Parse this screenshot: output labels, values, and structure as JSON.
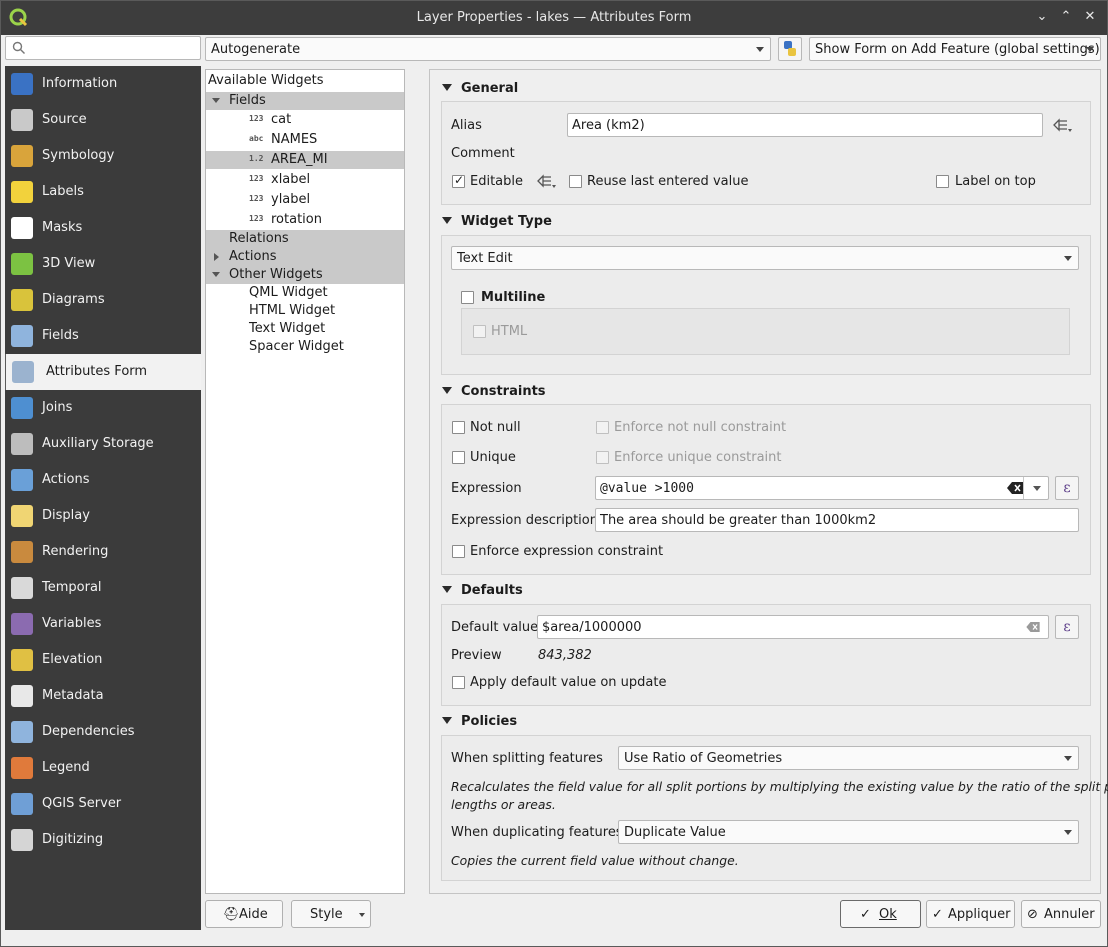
{
  "window": {
    "title": "Layer Properties - lakes — Attributes Form"
  },
  "search": {
    "placeholder": ""
  },
  "sidebar": {
    "items": [
      {
        "label": "Information",
        "icon": "information-icon",
        "color": "#3a72c4"
      },
      {
        "label": "Source",
        "icon": "source-icon",
        "color": "#c9c9c9"
      },
      {
        "label": "Symbology",
        "icon": "symbology-icon",
        "color": "#d9a43b"
      },
      {
        "label": "Labels",
        "icon": "labels-icon",
        "color": "#f2d23c"
      },
      {
        "label": "Masks",
        "icon": "masks-icon",
        "color": "#ffffff"
      },
      {
        "label": "3D View",
        "icon": "3d-view-icon",
        "color": "#7cc242"
      },
      {
        "label": "Diagrams",
        "icon": "diagrams-icon",
        "color": "#d9c33b"
      },
      {
        "label": "Fields",
        "icon": "fields-icon",
        "color": "#8fb4dd"
      },
      {
        "label": "Attributes Form",
        "icon": "attributes-form-icon",
        "color": "#9bb3cf"
      },
      {
        "label": "Joins",
        "icon": "joins-icon",
        "color": "#4e8fd1"
      },
      {
        "label": "Auxiliary Storage",
        "icon": "auxiliary-storage-icon",
        "color": "#bdbdbd"
      },
      {
        "label": "Actions",
        "icon": "actions-icon",
        "color": "#6aa0d8"
      },
      {
        "label": "Display",
        "icon": "display-icon",
        "color": "#f0d573"
      },
      {
        "label": "Rendering",
        "icon": "rendering-icon",
        "color": "#c98a3e"
      },
      {
        "label": "Temporal",
        "icon": "temporal-icon",
        "color": "#d9d9d9"
      },
      {
        "label": "Variables",
        "icon": "variables-icon",
        "color": "#8b6bb0"
      },
      {
        "label": "Elevation",
        "icon": "elevation-icon",
        "color": "#e0c043"
      },
      {
        "label": "Metadata",
        "icon": "metadata-icon",
        "color": "#e8e8e8"
      },
      {
        "label": "Dependencies",
        "icon": "dependencies-icon",
        "color": "#8fb4dd"
      },
      {
        "label": "Legend",
        "icon": "legend-icon",
        "color": "#e07a3b"
      },
      {
        "label": "QGIS Server",
        "icon": "qgis-server-icon",
        "color": "#6f9fd6"
      },
      {
        "label": "Digitizing",
        "icon": "digitizing-icon",
        "color": "#d5d5d5"
      }
    ],
    "selected_index": 8
  },
  "toolbar": {
    "layout_mode": "Autogenerate",
    "show_form": "Show Form on Add Feature (global settings)"
  },
  "tree": {
    "header": "Available Widgets",
    "fields_label": "Fields",
    "fields": [
      {
        "type": "123",
        "name": "cat"
      },
      {
        "type": "abc",
        "name": "NAMES"
      },
      {
        "type": "1.2",
        "name": "AREA_MI"
      },
      {
        "type": "123",
        "name": "xlabel"
      },
      {
        "type": "123",
        "name": "ylabel"
      },
      {
        "type": "123",
        "name": "rotation"
      }
    ],
    "relations_label": "Relations",
    "actions_label": "Actions",
    "other_label": "Other Widgets",
    "other": [
      "QML Widget",
      "HTML Widget",
      "Text Widget",
      "Spacer Widget"
    ]
  },
  "general": {
    "title": "General",
    "alias_label": "Alias",
    "alias_value": "Area (km2)",
    "comment_label": "Comment",
    "editable_label": "Editable",
    "reuse_label": "Reuse last entered value",
    "label_on_top": "Label on top"
  },
  "widget_type": {
    "title": "Widget Type",
    "value": "Text Edit",
    "multiline_label": "Multiline",
    "html_label": "HTML"
  },
  "constraints": {
    "title": "Constraints",
    "not_null": "Not null",
    "enforce_not_null": "Enforce not null constraint",
    "unique": "Unique",
    "enforce_unique": "Enforce unique constraint",
    "expression_label": "Expression",
    "expression_value": "@value >1000",
    "expr_desc_label": "Expression description",
    "expr_desc_value": "The area should be greater than 1000km2",
    "enforce_expr": "Enforce expression constraint"
  },
  "defaults": {
    "title": "Defaults",
    "default_label": "Default value",
    "default_value": "$area/1000000",
    "preview_label": "Preview",
    "preview_value": "843,382",
    "apply_update": "Apply default value on update"
  },
  "policies": {
    "title": "Policies",
    "split_label": "When splitting features",
    "split_value": "Use Ratio of Geometries",
    "split_desc1": "Recalculates the field value for all split portions by multiplying the existing value by the ratio of the split parts",
    "split_desc2": "lengths or areas.",
    "dup_label": "When duplicating features",
    "dup_value": "Duplicate Value",
    "dup_desc": "Copies the current field value without change."
  },
  "buttons": {
    "help": "Aide",
    "style": "Style",
    "ok": "Ok",
    "apply": "Appliquer",
    "cancel": "Annuler"
  },
  "epsilon": "ε"
}
